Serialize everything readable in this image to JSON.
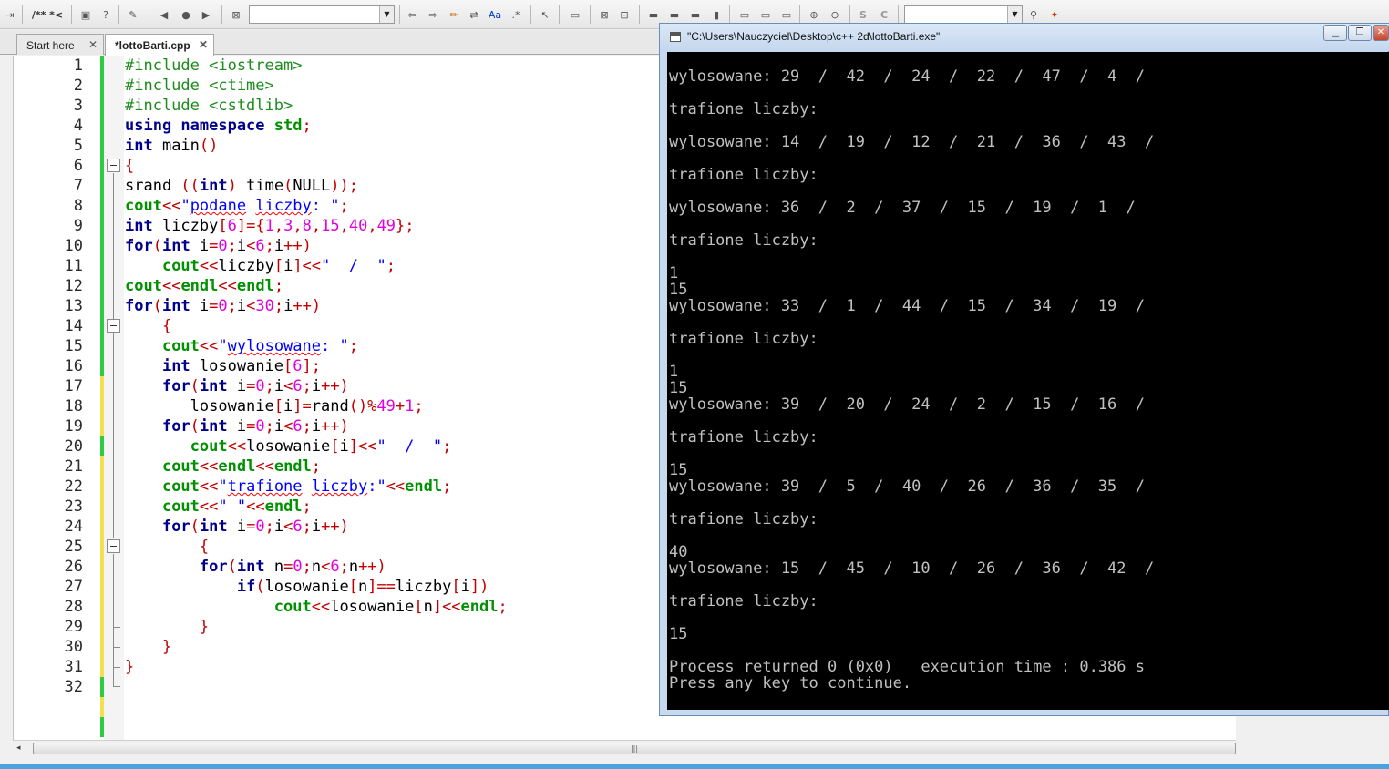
{
  "toolbar": {
    "comment_label": "/** *<",
    "search_combo_value": "",
    "symbol_combo_value": ""
  },
  "tabs": [
    {
      "label": "Start here"
    },
    {
      "label": "*lottoBarti.cpp"
    }
  ],
  "editor": {
    "line_numbers": [
      "1",
      "2",
      "3",
      "4",
      "5",
      "6",
      "7",
      "8",
      "9",
      "10",
      "11",
      "12",
      "13",
      "14",
      "15",
      "16",
      "17",
      "18",
      "19",
      "20",
      "21",
      "22",
      "23",
      "24",
      "25",
      "26",
      "27",
      "28",
      "29",
      "30",
      "31",
      "32"
    ]
  },
  "console": {
    "title": "\"C:\\Users\\Nauczyciel\\Desktop\\c++ 2d\\lottoBarti.exe\"",
    "lines": [
      "wylosowane: 29  /  42  /  24  /  22  /  47  /  4  /",
      "trafione liczby:",
      "wylosowane: 14  /  19  /  12  /  21  /  36  /  43  /",
      "trafione liczby:",
      "wylosowane: 36  /  2  /  37  /  15  /  19  /  1  /",
      "trafione liczby:",
      "1",
      "15",
      "wylosowane: 33  /  1  /  44  /  15  /  34  /  19  /",
      "trafione liczby:",
      "1",
      "15",
      "wylosowane: 39  /  20  /  24  /  2  /  15  /  16  /",
      "trafione liczby:",
      "15",
      "wylosowane: 39  /  5  /  40  /  26  /  36  /  35  /",
      "trafione liczby:",
      "40",
      "wylosowane: 15  /  45  /  10  /  26  /  36  /  42  /",
      "trafione liczby:",
      "15",
      "Process returned 0 (0x0)   execution time : 0.386 s",
      "Press any key to continue."
    ]
  },
  "colors": {
    "keyword": "#00008b",
    "preprocessor": "#1e8c1e",
    "stream": "#009000",
    "operator": "#c00000",
    "number": "#e000e0",
    "string": "#0000ff",
    "changebar_saved": "#2ecc40",
    "changebar_unsaved": "#f4e04d",
    "console_bg": "#000000",
    "console_text": "#c0c0c0"
  },
  "icons": [
    "save-icon",
    "help-icon",
    "wrench-icon",
    "prev-icon",
    "stop-icon",
    "next-icon",
    "clear-icon",
    "back-icon",
    "forward-icon",
    "highlight-icon",
    "replace-icon",
    "match-case-icon",
    "regex-icon",
    "select-icon",
    "frame-icon",
    "image-icon",
    "zoom-in-icon",
    "zoom-out-icon",
    "dollar-icon",
    "c-icon",
    "search-icon",
    "settings-icon"
  ]
}
